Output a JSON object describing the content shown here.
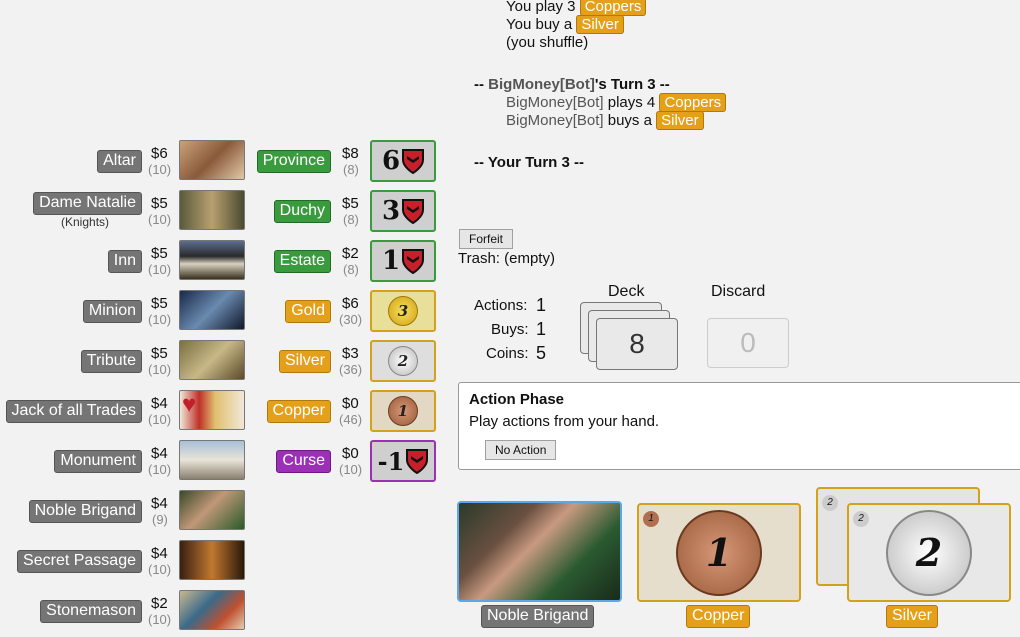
{
  "log": {
    "line1_prefix": "You play 3",
    "line1_card": "Coppers",
    "line2_prefix": "You buy a",
    "line2_card": "Silver",
    "line3": "(you shuffle)",
    "turn_header_prefix": "-- ",
    "turn_header_player": "BigMoney[Bot]",
    "turn_header_suffix": "'s Turn 3 --",
    "bot_line1_player": "BigMoney[Bot]",
    "bot_line1_verb": "plays 4",
    "bot_line1_card": "Coppers",
    "bot_line2_player": "BigMoney[Bot]",
    "bot_line2_verb": "buys a",
    "bot_line2_card": "Silver",
    "your_turn": "-- Your Turn 3 --"
  },
  "kingdom": [
    {
      "name": "Altar",
      "price": "$6",
      "count": "(10)"
    },
    {
      "name": "Dame Natalie",
      "sub": "(Knights)",
      "price": "$5",
      "count": "(10)"
    },
    {
      "name": "Inn",
      "price": "$5",
      "count": "(10)"
    },
    {
      "name": "Minion",
      "price": "$5",
      "count": "(10)"
    },
    {
      "name": "Tribute",
      "price": "$5",
      "count": "(10)"
    },
    {
      "name": "Jack of all Trades",
      "price": "$4",
      "count": "(10)"
    },
    {
      "name": "Monument",
      "price": "$4",
      "count": "(10)"
    },
    {
      "name": "Noble Brigand",
      "price": "$4",
      "count": "(9)"
    },
    {
      "name": "Secret Passage",
      "price": "$4",
      "count": "(10)"
    },
    {
      "name": "Stonemason",
      "price": "$2",
      "count": "(10)"
    }
  ],
  "basic": [
    {
      "name": "Province",
      "price": "$8",
      "count": "(8)",
      "value": "6"
    },
    {
      "name": "Duchy",
      "price": "$5",
      "count": "(8)",
      "value": "3"
    },
    {
      "name": "Estate",
      "price": "$2",
      "count": "(8)",
      "value": "1"
    },
    {
      "name": "Gold",
      "price": "$6",
      "count": "(30)",
      "value": "3"
    },
    {
      "name": "Silver",
      "price": "$3",
      "count": "(36)",
      "value": "2"
    },
    {
      "name": "Copper",
      "price": "$0",
      "count": "(46)",
      "value": "1"
    },
    {
      "name": "Curse",
      "price": "$0",
      "count": "(10)",
      "value": "-1"
    }
  ],
  "controls": {
    "forfeit": "Forfeit",
    "trash": "Trash: (empty)",
    "actions_label": "Actions:",
    "actions_value": "1",
    "buys_label": "Buys:",
    "buys_value": "1",
    "coins_label": "Coins:",
    "coins_value": "5",
    "deck_label": "Deck",
    "deck_count": "8",
    "discard_label": "Discard",
    "discard_count": "0"
  },
  "phase": {
    "title": "Action Phase",
    "instruction": "Play actions from your hand.",
    "button": "No Action"
  },
  "hand": [
    {
      "name": "Noble Brigand"
    },
    {
      "name": "Copper",
      "value": "1",
      "corner": "1"
    },
    {
      "name": "Silver",
      "value": "2",
      "corner": "2"
    }
  ],
  "colors": {
    "action": "#757575",
    "victory": "#3a9a3e",
    "treasure": "#e4a01a",
    "curse": "#9b2fb5"
  }
}
